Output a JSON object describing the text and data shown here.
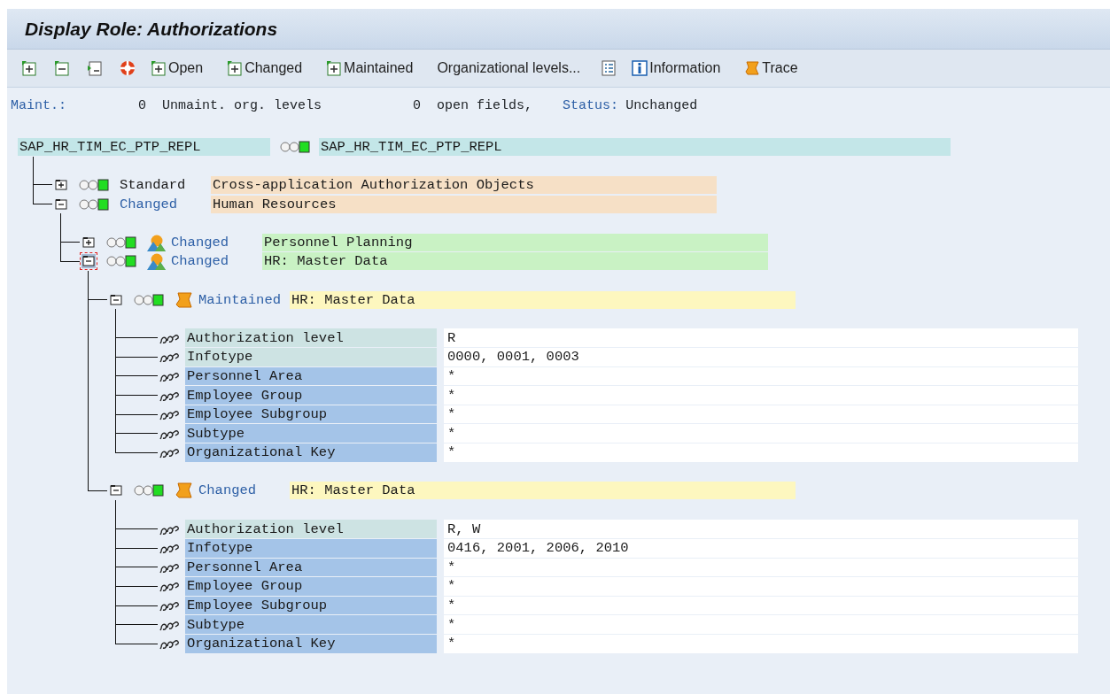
{
  "window": {
    "title": "Display Role: Authorizations"
  },
  "toolbar": [
    {
      "kind": "icon"
    },
    {
      "kind": "icon"
    },
    {
      "kind": "icon"
    },
    {
      "kind": "icon"
    },
    {
      "kind": "text",
      "label": "Open"
    },
    {
      "kind": "text",
      "label": "Changed"
    },
    {
      "kind": "text",
      "label": "Maintained"
    },
    {
      "kind": "plain",
      "label": "Organizational levels..."
    },
    {
      "kind": "icon"
    },
    {
      "kind": "text",
      "label": "Information"
    },
    {
      "kind": "text",
      "label": "Trace"
    }
  ],
  "status_line": {
    "maint_label": "Maint.:",
    "unmaint_count": "0",
    "unmaint_label": "Unmaint. org. levels",
    "open_count": "0",
    "open_label": "open fields,",
    "status_label": "Status:",
    "status_value": "Unchanged"
  },
  "tree": {
    "name": "SAP_HR_TIM_EC_PTP_REPL",
    "title": "SAP_HR_TIM_EC_PTP_REPL",
    "children": [
      {
        "kind": "area",
        "expanded": false,
        "focused": false,
        "status": "Standard",
        "color": "#1a1a1a",
        "text": "Cross-application Authorization Objects"
      },
      {
        "kind": "area",
        "expanded": true,
        "focused": false,
        "status": "Changed",
        "color": "#2d5fa6",
        "text": "Human Resources",
        "children": [
          {
            "kind": "class",
            "expanded": false,
            "focused": false,
            "status": "Changed",
            "color": "#2d5fa6",
            "text": "Personnel Planning"
          },
          {
            "kind": "class",
            "expanded": true,
            "focused": true,
            "status": "Changed",
            "color": "#2d5fa6",
            "text": "HR: Master Data",
            "children": [
              {
                "kind": "object",
                "expanded": true,
                "focused": false,
                "status": "Maintained",
                "color": "#2d5fa6",
                "text": "HR: Master Data",
                "fields": [
                  {
                    "label": "Authorization level",
                    "value": "R",
                    "color": "#cde3e3"
                  },
                  {
                    "label": "Infotype",
                    "value": "0000, 0001, 0003",
                    "color": "#cde3e3"
                  },
                  {
                    "label": "Personnel Area",
                    "value": "*",
                    "color": "#a4c4e8"
                  },
                  {
                    "label": "Employee Group",
                    "value": "*",
                    "color": "#a4c4e8"
                  },
                  {
                    "label": "Employee Subgroup",
                    "value": "*",
                    "color": "#a4c4e8"
                  },
                  {
                    "label": "Subtype",
                    "value": "*",
                    "color": "#a4c4e8"
                  },
                  {
                    "label": "Organizational Key",
                    "value": "*",
                    "color": "#a4c4e8"
                  }
                ]
              },
              {
                "kind": "object",
                "expanded": true,
                "focused": false,
                "status": "Changed",
                "color": "#2d5fa6",
                "text": "HR: Master Data",
                "fields": [
                  {
                    "label": "Authorization level",
                    "value": "R, W",
                    "color": "#cde3e3"
                  },
                  {
                    "label": "Infotype",
                    "value": "0416, 2001, 2006, 2010",
                    "color": "#a4c4e8"
                  },
                  {
                    "label": "Personnel Area",
                    "value": "*",
                    "color": "#a4c4e8"
                  },
                  {
                    "label": "Employee Group",
                    "value": "*",
                    "color": "#a4c4e8"
                  },
                  {
                    "label": "Employee Subgroup",
                    "value": "*",
                    "color": "#a4c4e8"
                  },
                  {
                    "label": "Subtype",
                    "value": "*",
                    "color": "#a4c4e8"
                  },
                  {
                    "label": "Organizational Key",
                    "value": "*",
                    "color": "#a4c4e8"
                  }
                ]
              }
            ]
          }
        ]
      }
    ]
  }
}
